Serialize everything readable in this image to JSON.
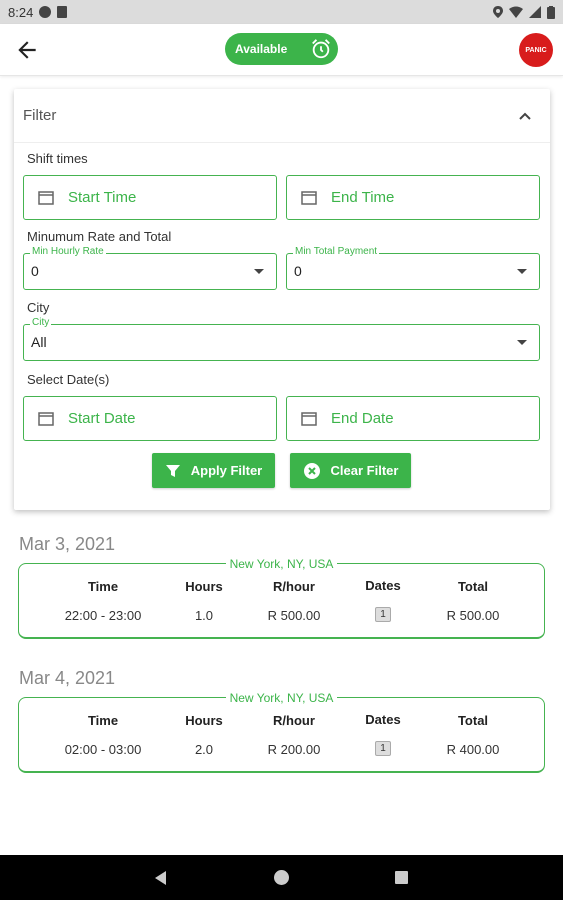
{
  "status_bar": {
    "time": "8:24"
  },
  "app_bar": {
    "availability_label": "Available",
    "panic_label": "PANIC"
  },
  "filter": {
    "title": "Filter",
    "shift_times_label": "Shift times",
    "start_time_placeholder": "Start Time",
    "end_time_placeholder": "End Time",
    "min_rate_label": "Minumum Rate and Total",
    "min_hourly_rate": {
      "legend": "Min Hourly Rate",
      "value": "0"
    },
    "min_total_payment": {
      "legend": "Min Total Payment",
      "value": "0"
    },
    "city_label": "City",
    "city_select": {
      "legend": "City",
      "value": "All"
    },
    "select_dates_label": "Select Date(s)",
    "start_date_placeholder": "Start Date",
    "end_date_placeholder": "End Date",
    "apply_label": "Apply Filter",
    "clear_label": "Clear Filter"
  },
  "columns": {
    "time": "Time",
    "hours": "Hours",
    "rate": "R/hour",
    "dates": "Dates",
    "total": "Total"
  },
  "shifts": [
    {
      "date": "Mar 3, 2021",
      "location": "New York, NY, USA",
      "time": "22:00 - 23:00",
      "hours": "1.0",
      "rate": "R 500.00",
      "dates_count": "1",
      "total": "R 500.00"
    },
    {
      "date": "Mar 4, 2021",
      "location": "New York, NY, USA",
      "time": "02:00 - 03:00",
      "hours": "2.0",
      "rate": "R 200.00",
      "dates_count": "1",
      "total": "R 400.00"
    }
  ],
  "colors": {
    "accent": "#3cb44a",
    "panic": "#d81c1c"
  }
}
